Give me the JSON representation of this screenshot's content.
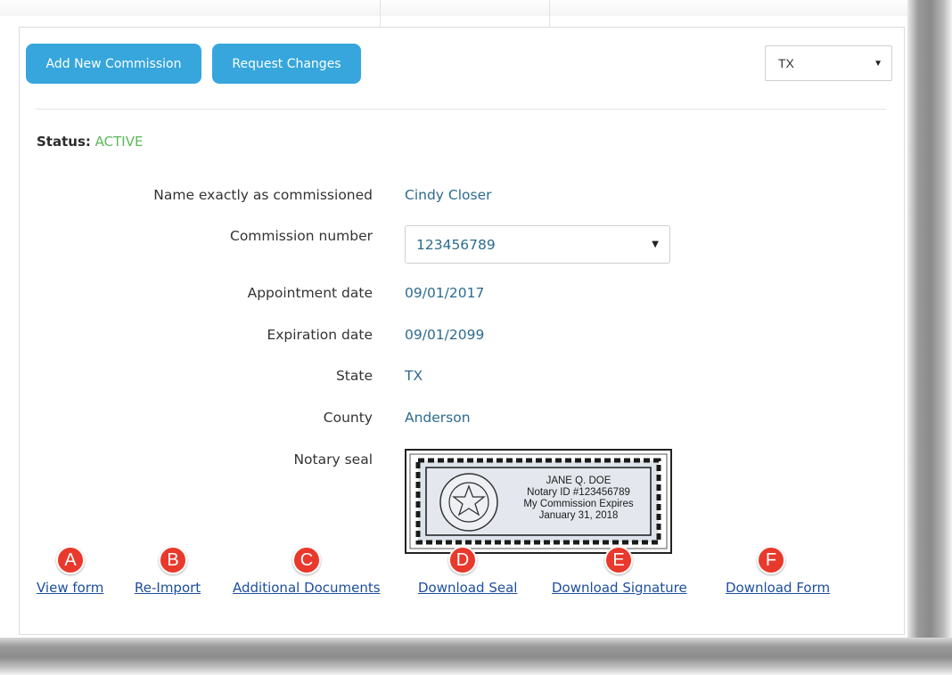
{
  "toolbar": {
    "add_label": "Add New Commission",
    "request_label": "Request Changes",
    "state_select_value": "TX"
  },
  "status": {
    "label": "Status:",
    "value": "ACTIVE"
  },
  "fields": {
    "name": {
      "label": "Name exactly as commissioned",
      "value": "Cindy Closer"
    },
    "commission_number": {
      "label": "Commission number",
      "value": "123456789"
    },
    "appointment_date": {
      "label": "Appointment date",
      "value": "09/01/2017"
    },
    "expiration_date": {
      "label": "Expiration date",
      "value": "09/01/2099"
    },
    "state": {
      "label": "State",
      "value": "TX"
    },
    "county": {
      "label": "County",
      "value": "Anderson"
    },
    "notary_seal": {
      "label": "Notary seal"
    }
  },
  "seal": {
    "line1": "JANE Q. DOE",
    "line2": "Notary ID #123456789",
    "line3": "My Commission Expires",
    "line4": "January 31, 2018"
  },
  "links": {
    "view_form": "View form",
    "re_import": "Re-Import",
    "additional_documents": "Additional Documents",
    "download_seal": "Download Seal",
    "download_signature": "Download Signature",
    "download_form": "Download Form"
  },
  "badges": [
    "A",
    "B",
    "C",
    "D",
    "E",
    "F"
  ],
  "colors": {
    "button": "#36a6dc",
    "status_active": "#5cb85c",
    "value_text": "#2d6b8e",
    "link": "#1c4e9c",
    "badge": "#e8392c"
  },
  "icons": {
    "select_caret": "caret-down-icon"
  }
}
